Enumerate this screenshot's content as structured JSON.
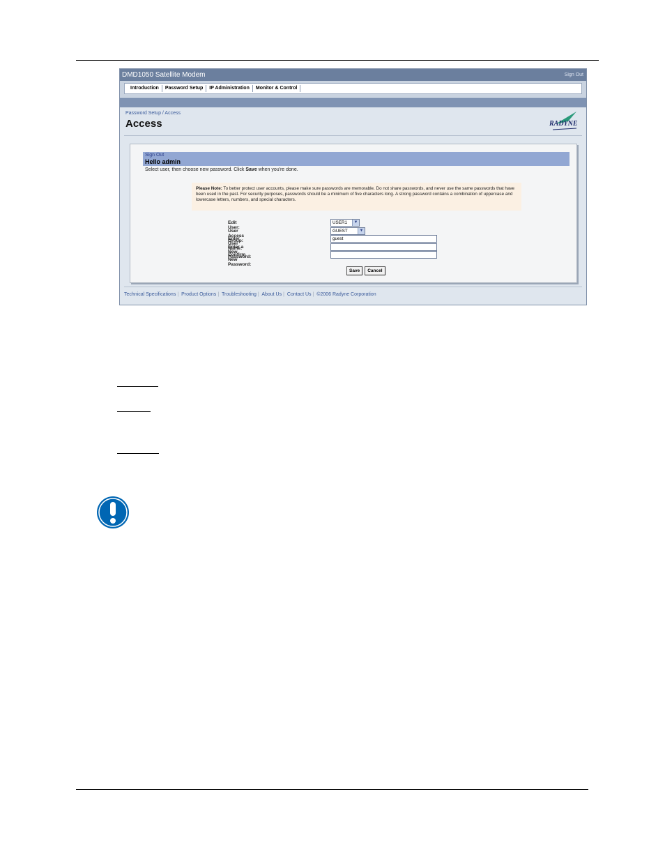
{
  "app": {
    "title": "DMD1050 Satellite Modem",
    "signout_top": "Sign Out"
  },
  "nav": {
    "items": [
      "Introduction",
      "Password Setup",
      "IP Administration",
      "Monitor & Control"
    ]
  },
  "header": {
    "breadcrumb": "Password Setup / Access",
    "title": "Access",
    "logo_text": "RADYNE"
  },
  "panel": {
    "signout": "Sign Out",
    "greeting": "Hello admin",
    "instruction_pre": "Select user, then choose new password. Click ",
    "instruction_bold": "Save",
    "instruction_post": " when you're done."
  },
  "note": {
    "label": "Please Note:",
    "text": " To better protect user accounts, please make sure passwords are memorable. Do not share passwords, and never use the same passwords that have been used in the past. For security purposes, passwords should be a minimum of five characters long. A strong password contains a combination of uppercase and lowercase letters, numbers, and special characters."
  },
  "form": {
    "edit_user_label": "Edit User:",
    "edit_user_value": "USER1",
    "access_group_label": "User Access Group:",
    "access_group_value": "GUEST",
    "user_name_label": "Enter User Name:",
    "user_name_value": "guest",
    "new_password_label": "Enter a New Password:",
    "new_password_value": "",
    "confirm_password_label": "Confirm New Password:",
    "confirm_password_value": ""
  },
  "buttons": {
    "save": "Save",
    "cancel": "Cancel"
  },
  "footer": {
    "links": [
      "Technical Specifications",
      "Product Options",
      "Troubleshooting",
      "About Us",
      "Contact Us"
    ],
    "copyright": "©2006 Radyne Corporation"
  },
  "colors": {
    "titlebar": "#6b7f9e",
    "panel_header": "#92a7d3",
    "note_bg": "#fbf0e3",
    "notice_icon": "#0066b3"
  },
  "icons": {
    "dropdown": "chevron-down-icon",
    "notice": "exclamation-icon",
    "logo": "radyne-logo"
  }
}
